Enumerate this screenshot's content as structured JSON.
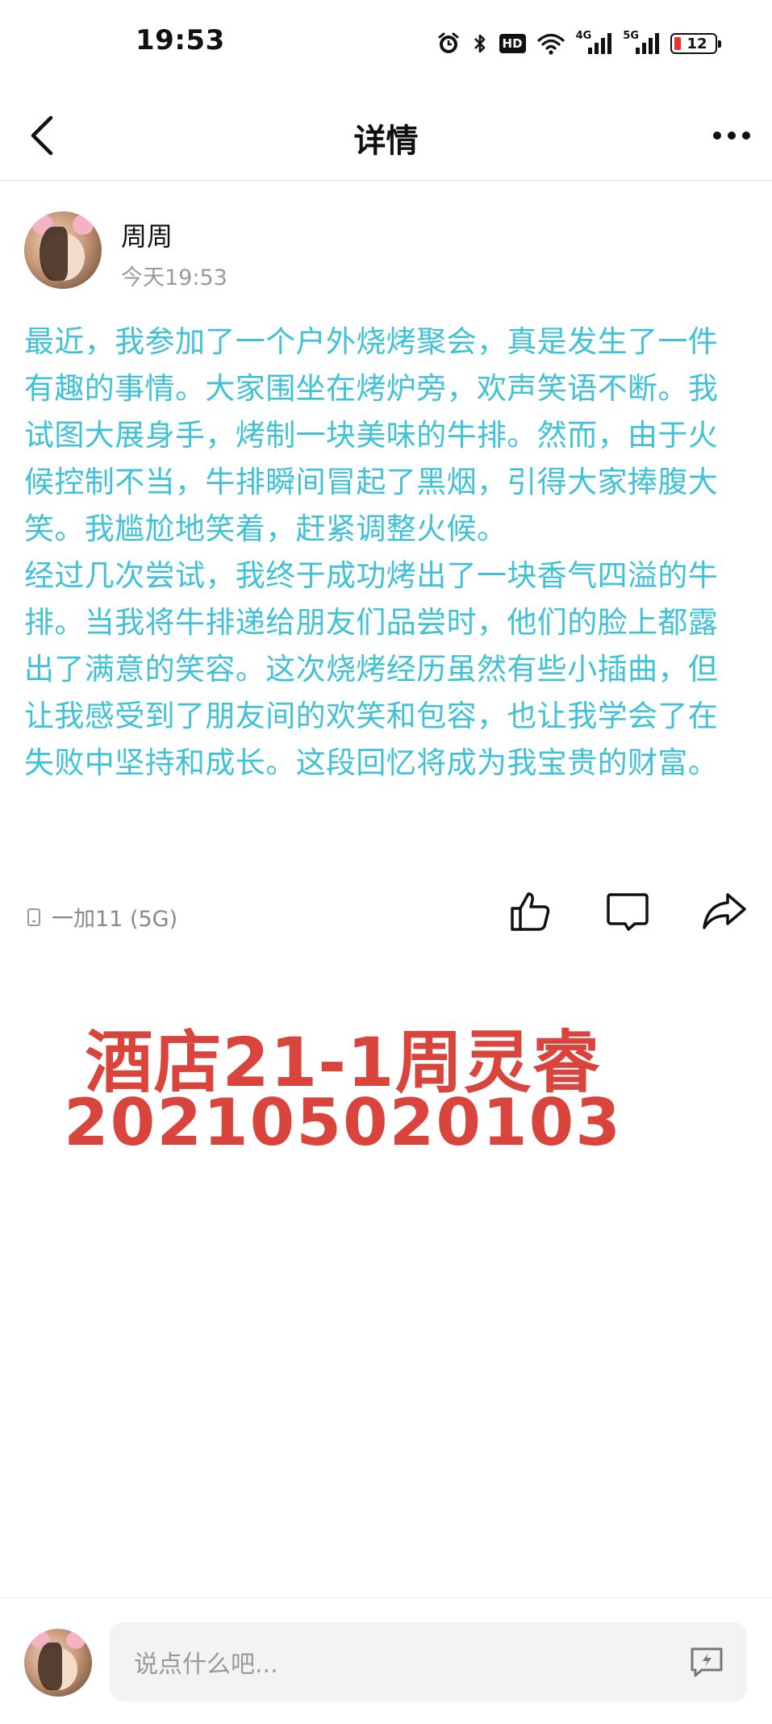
{
  "status_bar": {
    "time": "19:53",
    "icons": [
      "alarm-icon",
      "bluetooth-icon",
      "hd-icon",
      "wifi-icon",
      "signal-4g-icon",
      "signal-5g-icon",
      "battery-icon"
    ],
    "hd_label": "HD",
    "net1_label": "4G",
    "net2_label": "5G",
    "battery_level": "12",
    "battery_color": "#e0342c"
  },
  "nav": {
    "title": "详情",
    "back_icon": "chevron-left-icon",
    "more_icon": "more-dots-icon"
  },
  "post": {
    "author": "周周",
    "time": "今天19:53",
    "paragraphs": [
      "最近，我参加了一个户外烧烤聚会，真是发生了一件有趣的事情。大家围坐在烤炉旁，欢声笑语不断。我试图大展身手，烤制一块美味的牛排。然而，由于火候控制不当，牛排瞬间冒起了黑烟，引得大家捧腹大笑。我尴尬地笑着，赶紧调整火候。",
      "经过几次尝试，我终于成功烤出了一块香气四溢的牛排。当我将牛排递给朋友们品尝时，他们的脸上都露出了满意的笑容。这次烧烤经历虽然有些小插曲，但让我感受到了朋友间的欢笑和包容，也让我学会了在失败中坚持和成长。这段回忆将成为我宝贵的财富。"
    ],
    "text_color": "#3fc1d6",
    "device": "一加11 (5G)",
    "actions": [
      "like-icon",
      "comment-icon",
      "share-icon"
    ]
  },
  "watermark": {
    "line1": "酒店21-1周灵睿",
    "line2": "202105020103",
    "color": "#d9453c"
  },
  "comment_bar": {
    "placeholder": "说点什么吧...",
    "quick_icon": "quick-reply-icon"
  }
}
